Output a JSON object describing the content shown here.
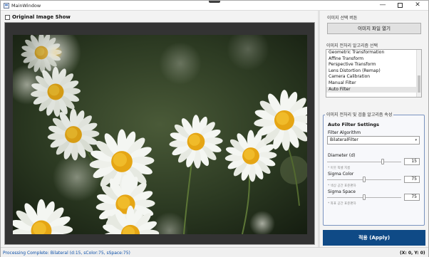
{
  "window": {
    "title": "MainWindow",
    "controls": {
      "minimize": "—",
      "maximize": "",
      "close": "✕"
    }
  },
  "left_panel": {
    "original_toggle_label": "Original Image Show",
    "original_toggle_checked": false
  },
  "right_panel": {
    "file_section_label": "이미지 선택 버튼",
    "open_file_button": "이미지 파일 열기",
    "algorithm_section_label": "이미지 전처리 알고리즘 선택",
    "algorithms": [
      "Geometric Transformation",
      "Affine Transform",
      "Perspective Transform",
      "Lens Distortion (Remap)",
      "Camera Calibration",
      "Manual Filter",
      "Auto Filter"
    ],
    "selected_algorithm": "Auto Filter",
    "properties_group_title": "이미지 전처리 및 검출 알고리즘 속성",
    "auto_filter": {
      "heading": "Auto Filter Settings",
      "filter_algorithm_label": "Filter Algorithm",
      "filter_algorithm_value": "BilateralFilter",
      "diameter_label": "Diameter (d)",
      "diameter_value": "15",
      "diameter_fraction": 0.75,
      "diameter_hint": "* 이웃 픽셀 지름",
      "sigma_color_label": "Sigma Color",
      "sigma_color_value": "75",
      "sigma_color_fraction": 0.5,
      "sigma_color_hint": "* 색상 공간 표준편차",
      "sigma_space_label": "Sigma Space",
      "sigma_space_value": "75",
      "sigma_space_fraction": 0.5,
      "sigma_space_hint": "* 좌표 공간 표준편차"
    },
    "apply_button": "적용 (Apply)"
  },
  "statusbar": {
    "message": "Processing Complete: Bilateral (d:15, sColor:75, sSpace:75)",
    "coords": "(X: 0, Y: 0)"
  },
  "colors": {
    "apply_button": "#0f4a86",
    "status_text": "#0a4ea8",
    "group_border": "#7a93c0",
    "image_frame": "#333333"
  },
  "icons": [
    "app-icon",
    "minimize-icon",
    "maximize-icon",
    "close-icon",
    "chevron-down-icon"
  ]
}
